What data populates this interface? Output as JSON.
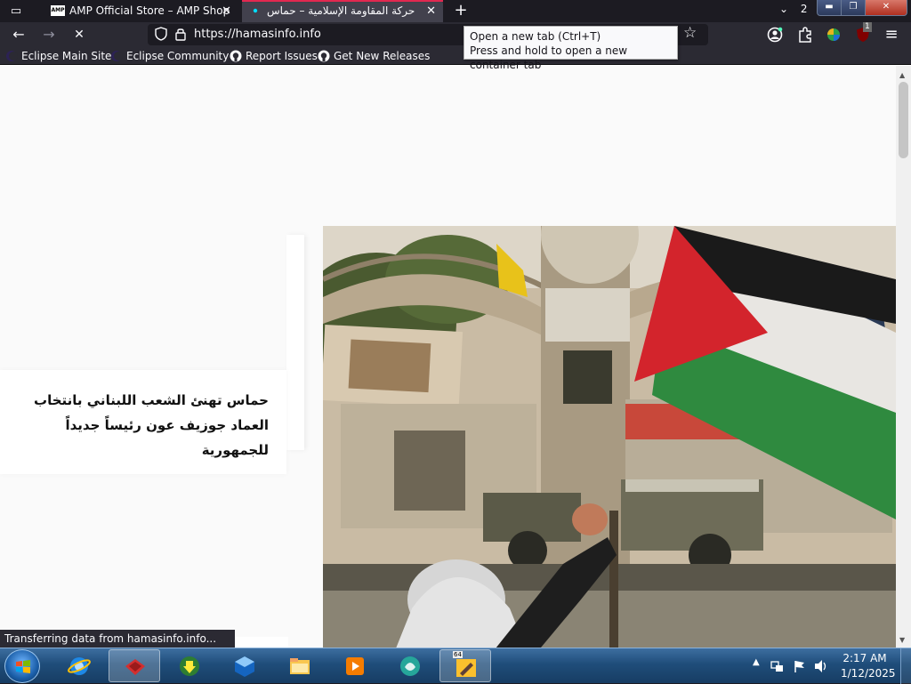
{
  "tabs": [
    {
      "icon": "amp-store-icon",
      "icon_text": "AMP",
      "title": "AMP Official Store – AMP Shop",
      "close": "✕"
    },
    {
      "icon": "firefox-loading-icon",
      "title": "حركة المقاومة الإسلامية – حماس",
      "close": "✕"
    }
  ],
  "tab_strip": {
    "new_tab": "+",
    "overflow": "⌄",
    "overflow_count": "2"
  },
  "window_controls": {
    "minimize": "▬",
    "maximize": "❐",
    "close": "✕"
  },
  "nav": {
    "back": "←",
    "forward": "→",
    "stop": "✕",
    "url": "https://hamasinfo.info",
    "bookmark_star": "☆",
    "menu": "≡",
    "ublock_count": "1"
  },
  "tooltip": {
    "line1": "Open a new tab (Ctrl+T)",
    "line2": "Press and hold to open a new container tab"
  },
  "bookmarks": [
    {
      "label": "Eclipse Main Site",
      "icon": "eclipse-icon"
    },
    {
      "label": "Eclipse Community",
      "icon": "eclipse-icon"
    },
    {
      "label": "Report Issues",
      "icon": "github-icon"
    },
    {
      "label": "Get New Releases",
      "icon": "github-icon"
    }
  ],
  "page": {
    "headline": "حماس تهنئ الشعب اللبناني بانتخاب العماد جوزيف عون رئيساً جديداً للجمهورية",
    "status": "Transferring data from hamasinfo.info..."
  },
  "taskbar": {
    "apps": [
      "internet-explorer-icon",
      "red-app-icon",
      "download-manager-icon",
      "virtualbox-icon",
      "file-explorer-icon",
      "media-player-icon",
      "teal-app-icon",
      "sixty-four-app-icon"
    ],
    "app_badge": "64",
    "time": "2:17 AM",
    "date": "1/12/2025"
  },
  "colors": {
    "accent": "#e22850",
    "toolbar": "#2b2a33",
    "tabbar": "#1c1b22",
    "flag_red": "#d3242c",
    "flag_green": "#2f8a3f"
  }
}
